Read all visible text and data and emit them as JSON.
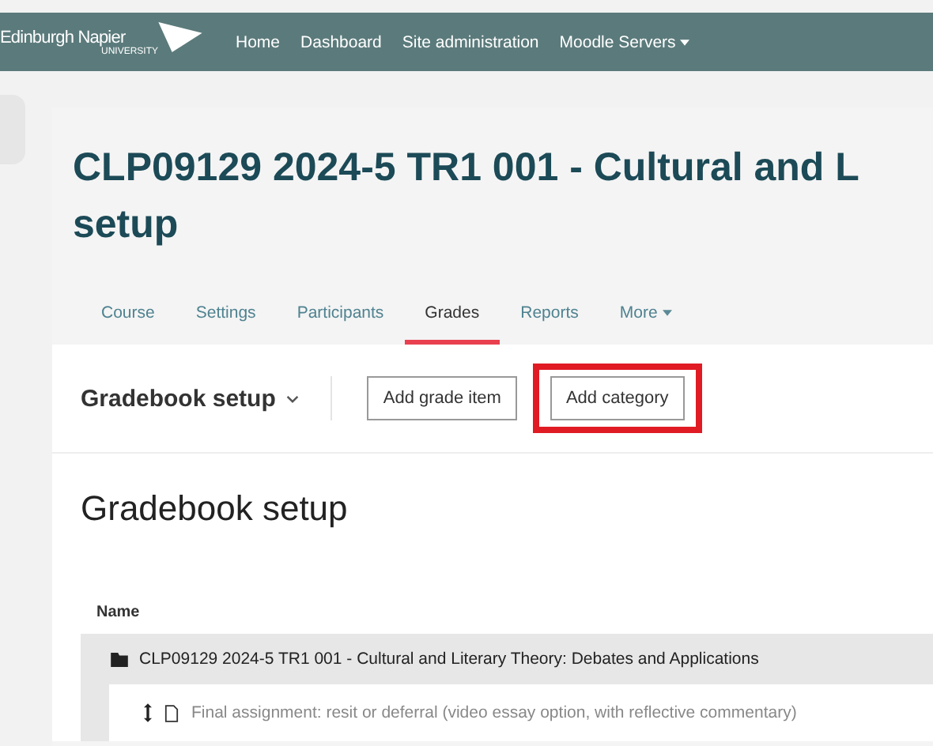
{
  "navbar": {
    "logo_name": "Edinburgh Napier",
    "logo_sub": "UNIVERSITY",
    "items": [
      {
        "label": "Home",
        "dropdown": false
      },
      {
        "label": "Dashboard",
        "dropdown": false
      },
      {
        "label": "Site administration",
        "dropdown": false
      },
      {
        "label": "Moodle Servers",
        "dropdown": true
      }
    ]
  },
  "page_title": {
    "line1": "CLP09129 2024-5 TR1 001 - Cultural and L",
    "line2": "setup"
  },
  "tabs": [
    {
      "label": "Course",
      "selected": false,
      "dropdown": false
    },
    {
      "label": "Settings",
      "selected": false,
      "dropdown": false
    },
    {
      "label": "Participants",
      "selected": false,
      "dropdown": false
    },
    {
      "label": "Grades",
      "selected": true,
      "dropdown": false
    },
    {
      "label": "Reports",
      "selected": false,
      "dropdown": false
    },
    {
      "label": "More",
      "selected": false,
      "dropdown": true
    }
  ],
  "action_bar": {
    "selector": "Gradebook setup",
    "buttons": [
      {
        "label": "Add grade item",
        "highlighted": false
      },
      {
        "label": "Add category",
        "highlighted": true
      }
    ]
  },
  "heading": "Gradebook setup",
  "table": {
    "columns": [
      "Name"
    ],
    "rows": [
      {
        "kind": "category",
        "name": "CLP09129 2024-5 TR1 001 - Cultural and Literary Theory: Debates and Applications"
      },
      {
        "kind": "item",
        "name": "Final assignment: resit or deferral (video essay option, with reflective commentary)"
      }
    ]
  }
}
